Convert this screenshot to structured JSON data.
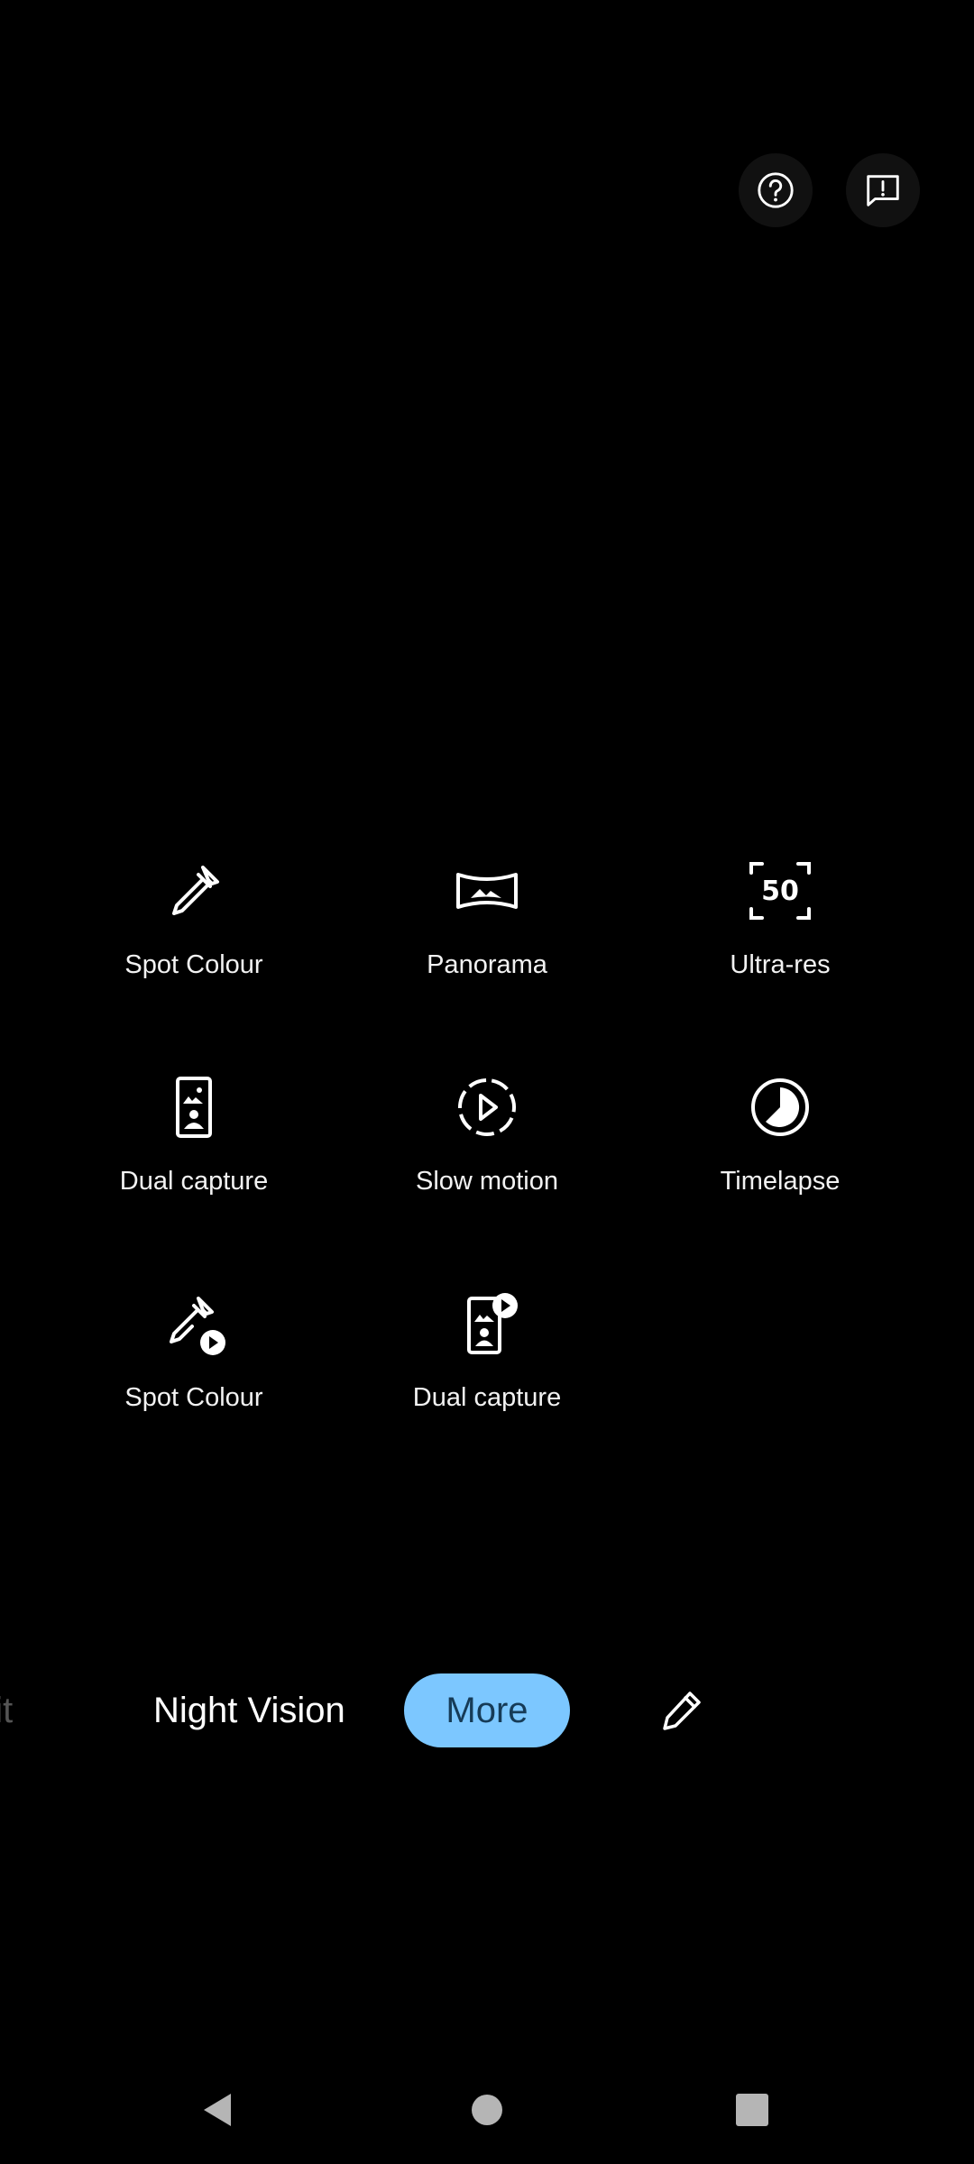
{
  "top_actions": {
    "help_icon": "question-circle-icon",
    "feedback_icon": "feedback-chat-icon"
  },
  "modes": [
    {
      "label": "Spot Colour",
      "icon": "eyedropper-icon"
    },
    {
      "label": "Panorama",
      "icon": "panorama-icon"
    },
    {
      "label": "Ultra-res",
      "icon": "ultra-res-50-icon",
      "icon_text": "50"
    },
    {
      "label": "Dual capture",
      "icon": "dual-capture-icon"
    },
    {
      "label": "Slow motion",
      "icon": "slow-motion-icon"
    },
    {
      "label": "Timelapse",
      "icon": "timelapse-icon"
    },
    {
      "label": "Spot Colour",
      "icon": "eyedropper-video-icon"
    },
    {
      "label": "Dual capture",
      "icon": "dual-capture-video-icon"
    }
  ],
  "mode_strip": {
    "prev_partial": "ait",
    "night_vision": "Night Vision",
    "more": "More",
    "edit_icon": "pencil-icon"
  },
  "colors": {
    "accent": "#7cc7ff",
    "accent_text": "#163b57",
    "background": "#000000"
  },
  "nav": {
    "back_icon": "back-triangle-icon",
    "home_icon": "home-circle-icon",
    "recents_icon": "recents-square-icon"
  }
}
